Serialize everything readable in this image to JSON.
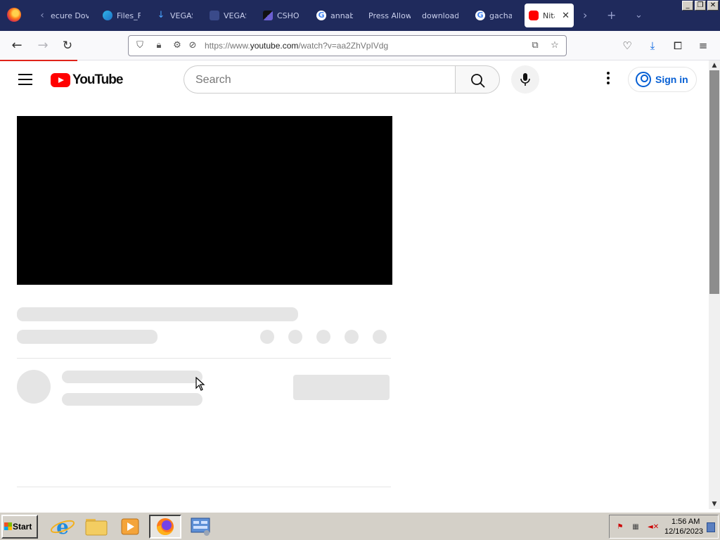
{
  "browser": {
    "tabs": [
      {
        "title": "ecure Dov",
        "favicon": "back-chevron-icon"
      },
      {
        "title": "Files_F",
        "favicon": "edge-icon"
      },
      {
        "title": "VEGAS",
        "favicon": "download-arrow-icon"
      },
      {
        "title": "VEGAS",
        "favicon": "vegas-icon"
      },
      {
        "title": "CSHO",
        "favicon": "cshop-icon"
      },
      {
        "title": "annab",
        "favicon": "google-icon"
      },
      {
        "title": "Press Allow",
        "favicon": ""
      },
      {
        "title": "download",
        "favicon": ""
      },
      {
        "title": "gacha",
        "favicon": "google-icon"
      },
      {
        "title": "Nita",
        "favicon": "youtube-icon",
        "active": true
      }
    ],
    "url_prefix": "https://www.",
    "url_domain": "youtube.com",
    "url_path": "/watch?v=aa2ZhVpIVdg",
    "window_controls": {
      "minimize": "_",
      "restore": "❐",
      "close": "✕"
    }
  },
  "youtube": {
    "logo_text": "YouTube",
    "search_placeholder": "Search",
    "sign_in_label": "Sign in",
    "brand_color": "#ff0000",
    "link_color": "#065fd4"
  },
  "taskbar": {
    "start_label": "Start",
    "clock_time": "1:56 AM",
    "clock_date": "12/16/2023"
  }
}
